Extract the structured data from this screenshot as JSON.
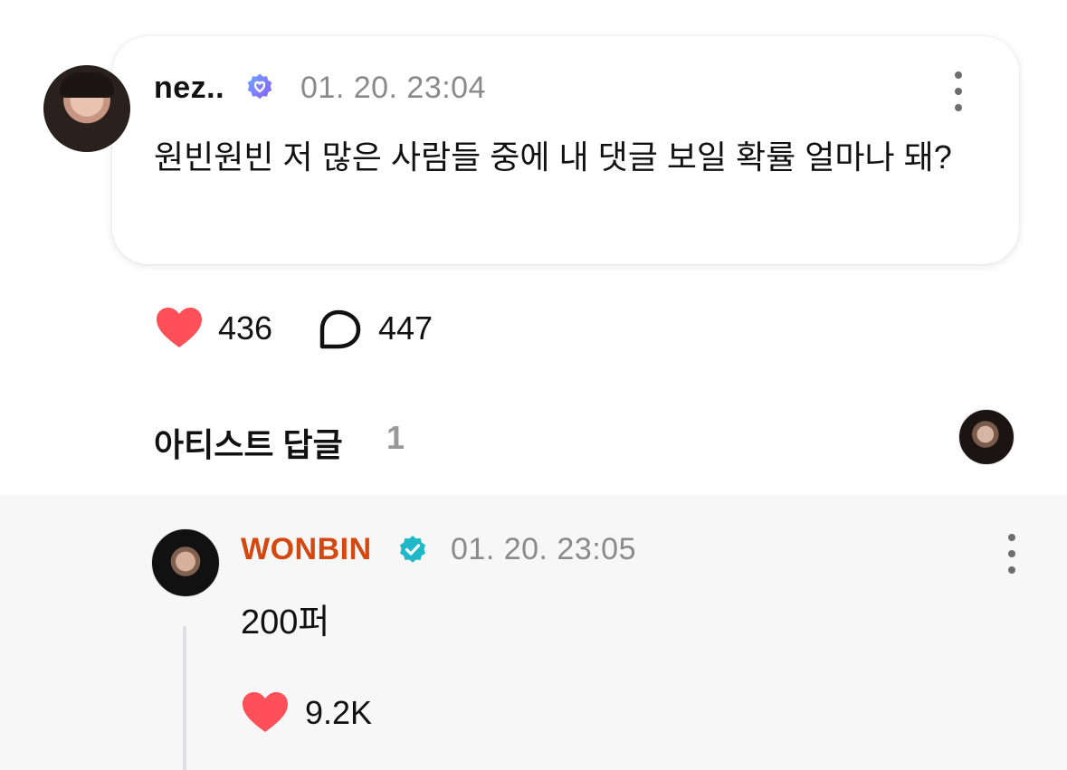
{
  "comment": {
    "username": "nez..",
    "badge_icon": "verified-heart-badge-icon",
    "timestamp": "01. 20. 23:04",
    "text": "원빈원빈 저 많은 사람들 중에 내 댓글 보일 확률 얼마나 돼?",
    "likes": "436",
    "replies": "447",
    "heart_color": "#ff4f58",
    "badge_color": "#7b61ff"
  },
  "artist_replies": {
    "title": "아티스트 답글",
    "count": "1"
  },
  "reply": {
    "username": "WONBIN",
    "username_color": "#d4480f",
    "badge_icon": "verified-check-badge-icon",
    "badge_color": "#1fb8c8",
    "timestamp": "01. 20. 23:05",
    "text": "200퍼",
    "likes": "9.2K"
  }
}
